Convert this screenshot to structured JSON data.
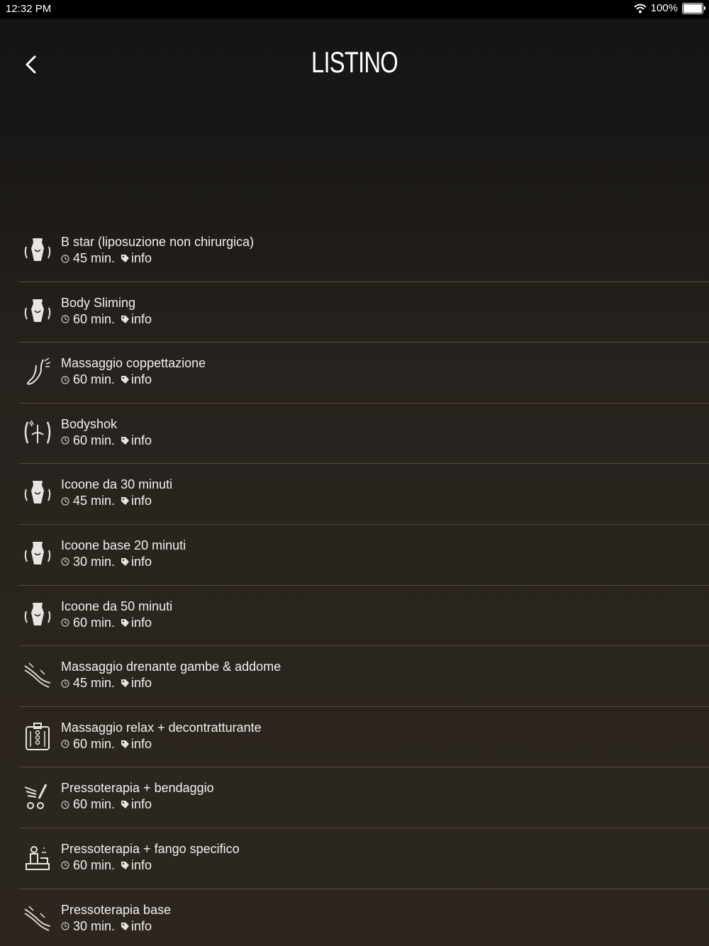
{
  "status_bar": {
    "time": "12:32 PM",
    "battery": "100%"
  },
  "header": {
    "title": "LISTINO"
  },
  "services": [
    {
      "name": "B star (liposuzione non chirurgica)",
      "duration": "45 min.",
      "info": "info",
      "icon": "body-contour-icon"
    },
    {
      "name": "Body Sliming",
      "duration": "60 min.",
      "info": "info",
      "icon": "body-contour-icon"
    },
    {
      "name": "Massaggio coppettazione",
      "duration": "60 min.",
      "info": "info",
      "icon": "leg-massage-icon"
    },
    {
      "name": "Bodyshok",
      "duration": "60 min.",
      "info": "info",
      "icon": "body-shock-icon"
    },
    {
      "name": "Icoone da  30 minuti",
      "duration": "45 min.",
      "info": "info",
      "icon": "body-contour-icon"
    },
    {
      "name": "Icoone base 20 minuti",
      "duration": "30 min.",
      "info": "info",
      "icon": "body-contour-icon"
    },
    {
      "name": "Icoone da 50 minuti",
      "duration": "60 min.",
      "info": "info",
      "icon": "body-contour-icon"
    },
    {
      "name": "Massaggio drenante gambe & addome",
      "duration": "45 min.",
      "info": "info",
      "icon": "legs-drain-icon"
    },
    {
      "name": "Massaggio relax + decontratturante",
      "duration": "60 min.",
      "info": "info",
      "icon": "back-massage-icon"
    },
    {
      "name": "Pressoterapia + bendaggio",
      "duration": "60 min.",
      "info": "info",
      "icon": "pressotherapy-bandage-icon"
    },
    {
      "name": "Pressoterapia + fango specifico",
      "duration": "60 min.",
      "info": "info",
      "icon": "pressotherapy-mud-icon"
    },
    {
      "name": "Pressoterapia base",
      "duration": "30 min.",
      "info": "info",
      "icon": "legs-drain-icon"
    }
  ]
}
